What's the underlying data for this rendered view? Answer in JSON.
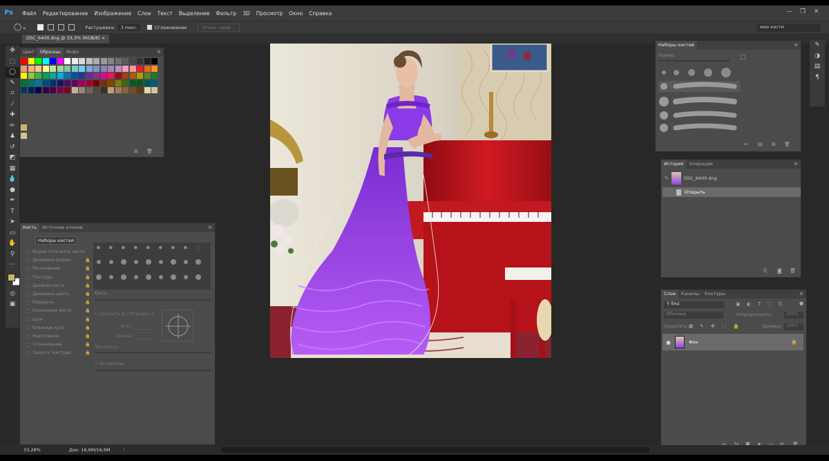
{
  "menubar": {
    "logo": "Ps",
    "items": [
      "Файл",
      "Редактирование",
      "Изображение",
      "Слои",
      "Текст",
      "Выделение",
      "Фильтр",
      "3D",
      "Просмотр",
      "Окно",
      "Справка"
    ]
  },
  "options": {
    "feather_label": "Растушевка:",
    "feather_value": "3 пикс.",
    "smoothing_label": "Сглаживание",
    "refine_button": "Уточн. край...",
    "workspace": "мои кисти"
  },
  "document": {
    "tab": "DSC_6400.dng @ 33,3% (RGB/8)"
  },
  "swatches_panel": {
    "tabs": [
      "Цвет",
      "Образцы",
      "Инфо"
    ],
    "active_tab": "Образцы"
  },
  "brush_panel": {
    "tabs": [
      "Кисть",
      "Источник клонов"
    ],
    "presets_button": "Наборы кистей",
    "options": [
      "Форма отпечатка кисти",
      "Динамика формы",
      "Рассеивание",
      "Текстура",
      "Двойная кисть",
      "Динамика цвета",
      "Передача",
      "Положение кисти",
      "Шум",
      "Влажные края",
      "Накопление",
      "Сглаживание",
      "Защита текстуры"
    ],
    "size_label": "Кисть",
    "flip_x": "Отразить X",
    "flip_y": "Отразить Y",
    "angle_label": "Угол:",
    "roundness_label": "Форма:",
    "hardness_label": "Жесткость",
    "spacing_label": "Интервалы"
  },
  "brush_presets_panel": {
    "title": "Наборы кистей",
    "size_label": "Размер:"
  },
  "history_panel": {
    "tabs": [
      "История",
      "Операции"
    ],
    "snapshot": "DSC_6400.dng",
    "state": "Открыть"
  },
  "layers_panel": {
    "tabs": [
      "Слои",
      "Каналы",
      "Контуры"
    ],
    "filter_label": "Вид",
    "blend_mode": "Обычные",
    "opacity_label": "Непрозрачность:",
    "opacity_value": "100%",
    "lock_label": "Закрепить:",
    "fill_label": "Заливка:",
    "fill_value": "100%",
    "layer_name": "Фон"
  },
  "status": {
    "zoom": "33,28%",
    "doc": "Док: 16,6М/16,6М"
  },
  "colors": {
    "app_bg": "#282828",
    "panel": "#4b4b4b",
    "ps_blue": "#31a8ff",
    "dress": "#9b3fe6",
    "piano": "#c4141b"
  }
}
